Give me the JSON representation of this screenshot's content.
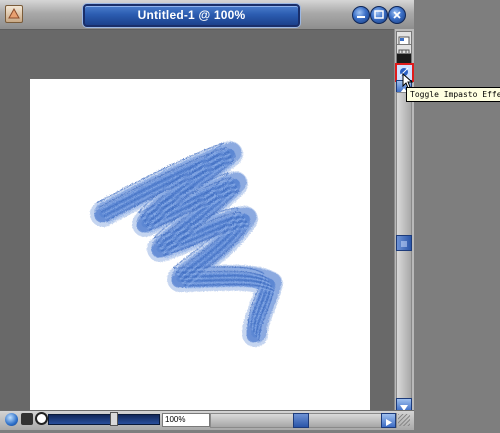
{
  "window": {
    "title": "Untitled-1 @ 100%",
    "icons": [
      "app-icon",
      "minimize-icon",
      "maximize-icon",
      "close-icon"
    ]
  },
  "canvas": {
    "background_color": "#ffffff",
    "stroke_color": "#5b86d3"
  },
  "tool_column": {
    "icons": [
      "grid-toggle-icon",
      "grid-icon",
      "black-square-icon",
      "eye-icon",
      "impasto-toggle-icon",
      "scroll-up-icon",
      "scroll-down-icon"
    ],
    "highlight_color": "#e01b1b"
  },
  "tooltip": {
    "text": "Toggle Impasto Effect"
  },
  "status_bar": {
    "zoom_value": "100%",
    "icons": [
      "globe-icon",
      "binoculars-icon",
      "zoom-icon",
      "scroll-right-icon",
      "resize-grip-icon"
    ]
  }
}
